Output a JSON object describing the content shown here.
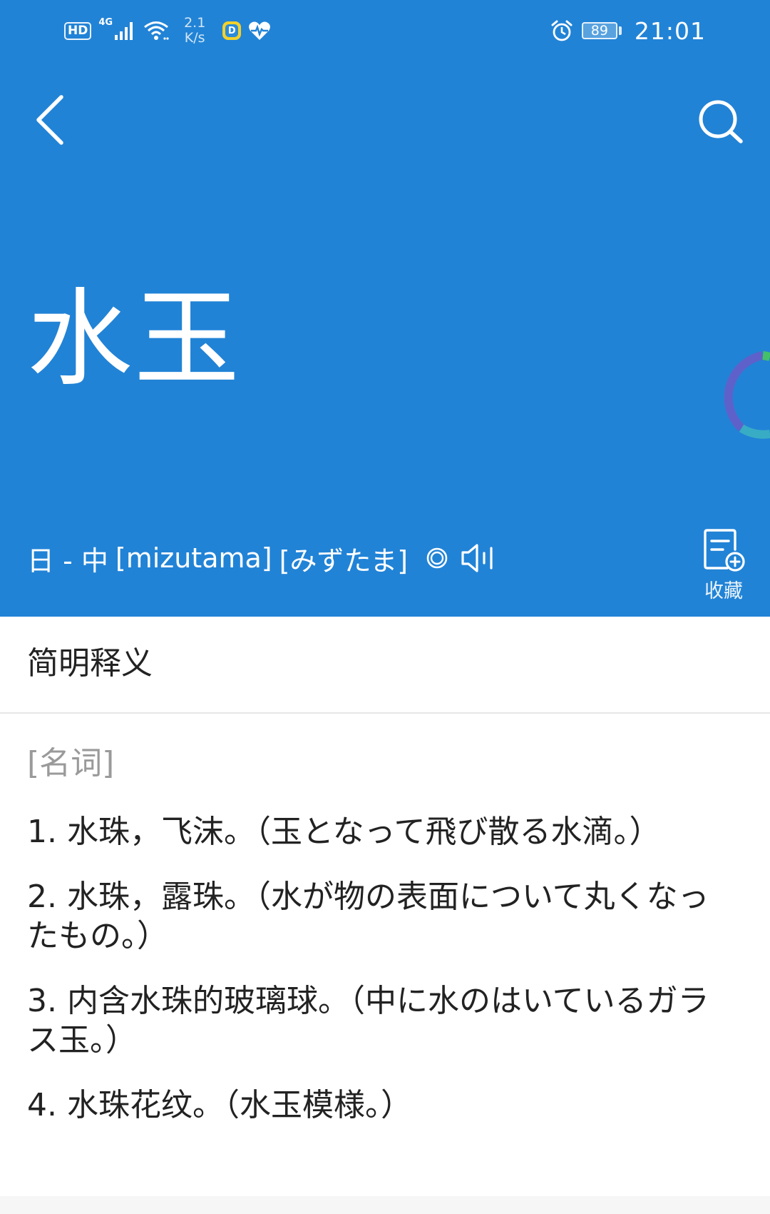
{
  "status_bar": {
    "hd": "HD",
    "network": "4G",
    "speed_value": "2.1",
    "speed_unit": "K/s",
    "app_badge": "D",
    "battery": "89",
    "time": "21:01"
  },
  "header": {
    "word": "水玉",
    "dict_direction": "日 - 中",
    "romaji": "[mizutama]",
    "kana": "[みずたま]",
    "collect_label": "收藏"
  },
  "section": {
    "title": "简明释义",
    "pos": "[名词]"
  },
  "definitions": [
    "1. 水珠，飞沫。（玉となって飛び散る水滴。）",
    "2. 水珠，露珠。（水が物の表面について丸くなったもの。）",
    "3. 内含水珠的玻璃球。（中に水のはいているガラス玉。）",
    "4. 水珠花纹。（水玉模様。）"
  ],
  "colors": {
    "header_bg": "#2183d6",
    "text": "#222222",
    "pos_text": "#9a9a9a"
  },
  "icons": [
    "hd-icon",
    "signal-icon",
    "wifi-icon",
    "heart-pulse-icon",
    "alarm-icon",
    "battery-icon",
    "back-arrow-icon",
    "search-icon",
    "target-icon",
    "speaker-icon",
    "collect-icon",
    "loader-icon"
  ]
}
